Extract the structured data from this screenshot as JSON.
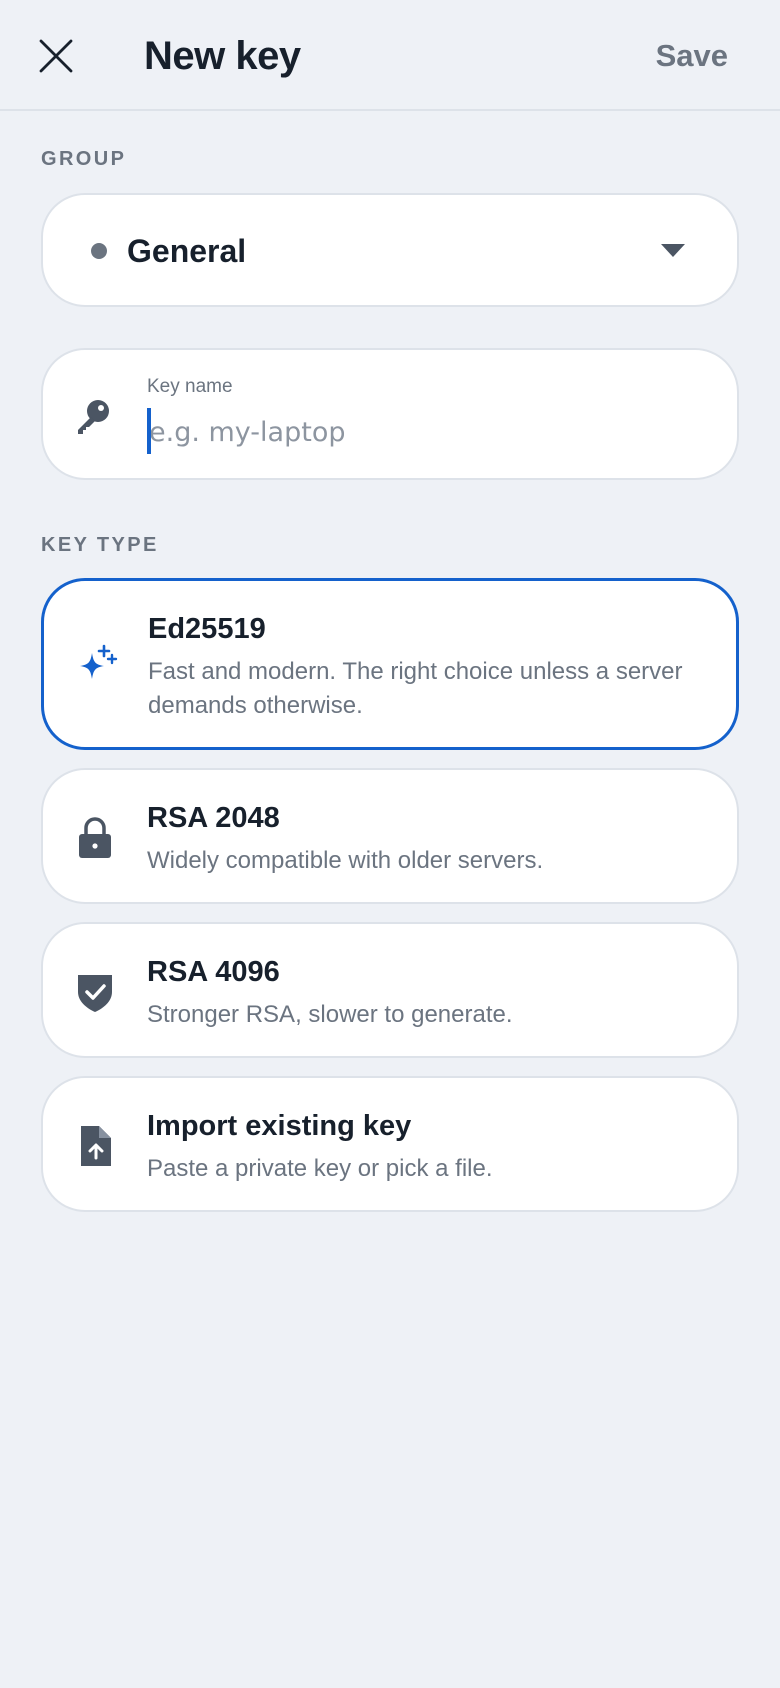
{
  "header": {
    "title": "New key",
    "save_label": "Save",
    "close_icon": "close-icon"
  },
  "group": {
    "section_label": "GROUP",
    "selected": "General",
    "dot_color": "#6b7480"
  },
  "key_name": {
    "label": "Key name",
    "placeholder": "e.g. my-laptop",
    "value": "",
    "icon": "key-icon"
  },
  "key_type": {
    "section_label": "KEY TYPE",
    "selected_index": 0,
    "options": [
      {
        "title": "Ed25519",
        "description": "Fast and modern. The right choice unless a server demands otherwise.",
        "icon": "sparkle-icon"
      },
      {
        "title": "RSA 2048",
        "description": "Widely compatible with older servers.",
        "icon": "lock-icon"
      },
      {
        "title": "RSA 4096",
        "description": "Stronger RSA, slower to generate.",
        "icon": "shield-check-icon"
      },
      {
        "title": "Import existing key",
        "description": "Paste a private key or pick a file.",
        "icon": "file-upload-icon"
      }
    ]
  },
  "colors": {
    "accent": "#1461cc",
    "background": "#eef1f6",
    "card": "#ffffff",
    "muted_text": "#6b7480",
    "text": "#17202c"
  }
}
